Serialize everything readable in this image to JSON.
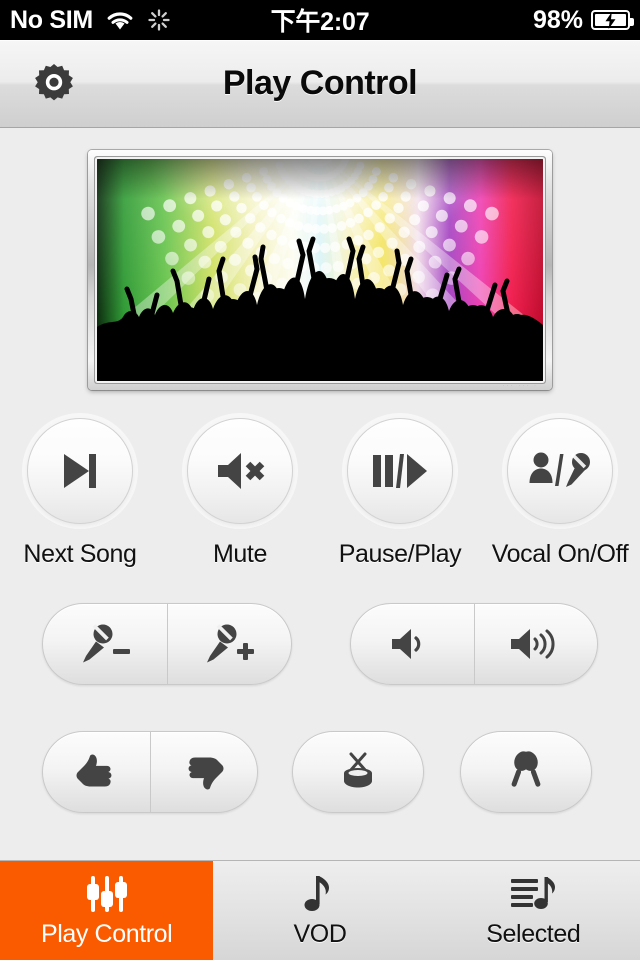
{
  "status_bar": {
    "carrier": "No SIM",
    "wifi_icon": "wifi-icon",
    "activity_icon": "activity-spinner-icon",
    "time": "下午2:07",
    "battery_percent": "98%",
    "battery_icon": "battery-charging-icon"
  },
  "nav_bar": {
    "settings_icon": "gear-icon",
    "title": "Play Control"
  },
  "tv_preview": {
    "alt": "karaoke-concert-crowd-image",
    "brand_text": "···  ···  ·"
  },
  "controls": {
    "round_buttons": [
      {
        "label": "Next Song",
        "icon": "skip-next-icon"
      },
      {
        "label": "Mute",
        "icon": "speaker-mute-icon"
      },
      {
        "label": "Pause/Play",
        "icon": "pause-play-icon"
      },
      {
        "label": "Vocal On/Off",
        "icon": "vocal-on-off-icon"
      }
    ],
    "mic_volume": {
      "name": "mic-volume-group",
      "down": {
        "icon": "mic-minus-icon",
        "label": "Mic Volume Down"
      },
      "up": {
        "icon": "mic-plus-icon",
        "label": "Mic Volume Up"
      }
    },
    "master_volume": {
      "name": "master-volume-group",
      "down": {
        "icon": "volume-down-icon",
        "label": "Volume Down"
      },
      "up": {
        "icon": "volume-up-icon",
        "label": "Volume Up"
      }
    },
    "rating": {
      "name": "rating-group",
      "up": {
        "icon": "thumbs-up-icon",
        "label": "Thumbs Up"
      },
      "down": {
        "icon": "thumbs-down-icon",
        "label": "Thumbs Down"
      }
    },
    "drum": {
      "icon": "drum-icon",
      "label": "Drum Sound Effect"
    },
    "maracas": {
      "icon": "maracas-icon",
      "label": "Maracas Sound Effect"
    }
  },
  "tab_bar": {
    "active_index": 0,
    "accent_color": "#fa5b00",
    "tabs": [
      {
        "label": "Play Control",
        "icon": "equalizer-sliders-icon"
      },
      {
        "label": "VOD",
        "icon": "music-note-icon"
      },
      {
        "label": "Selected",
        "icon": "playlist-note-icon"
      }
    ]
  }
}
